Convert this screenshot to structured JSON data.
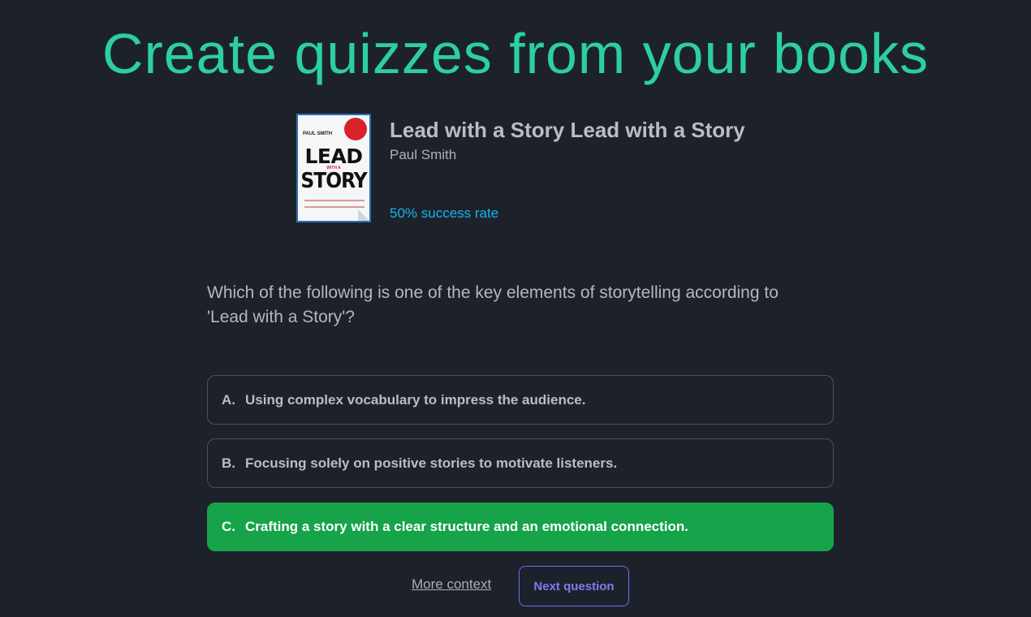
{
  "hero": {
    "title": "Create quizzes from your books"
  },
  "book": {
    "title": "Lead with a Story Lead with a Story",
    "author": "Paul Smith",
    "success_rate": "50% success rate",
    "cover": {
      "author": "PAUL SMITH",
      "title_top": "LEAD",
      "title_mid": "WITH A",
      "title_bottom": "STORY"
    }
  },
  "quiz": {
    "question": "Which of the following is one of the key elements of storytelling according to 'Lead with a Story'?",
    "options": [
      {
        "letter": "A.",
        "text": "Using complex vocabulary to impress the audience.",
        "selected": false
      },
      {
        "letter": "B.",
        "text": "Focusing solely on positive stories to motivate listeners.",
        "selected": false
      },
      {
        "letter": "C.",
        "text": "Crafting a story with a clear structure and an emotional connection.",
        "selected": true
      }
    ]
  },
  "actions": {
    "more_context": "More context",
    "next_question": "Next question"
  },
  "colors": {
    "background": "#1d222a",
    "hero_accent": "#2ccfa3",
    "success_rate": "#19b3f2",
    "selected_option": "#16a34a",
    "next_button": "#7b7cf4"
  }
}
